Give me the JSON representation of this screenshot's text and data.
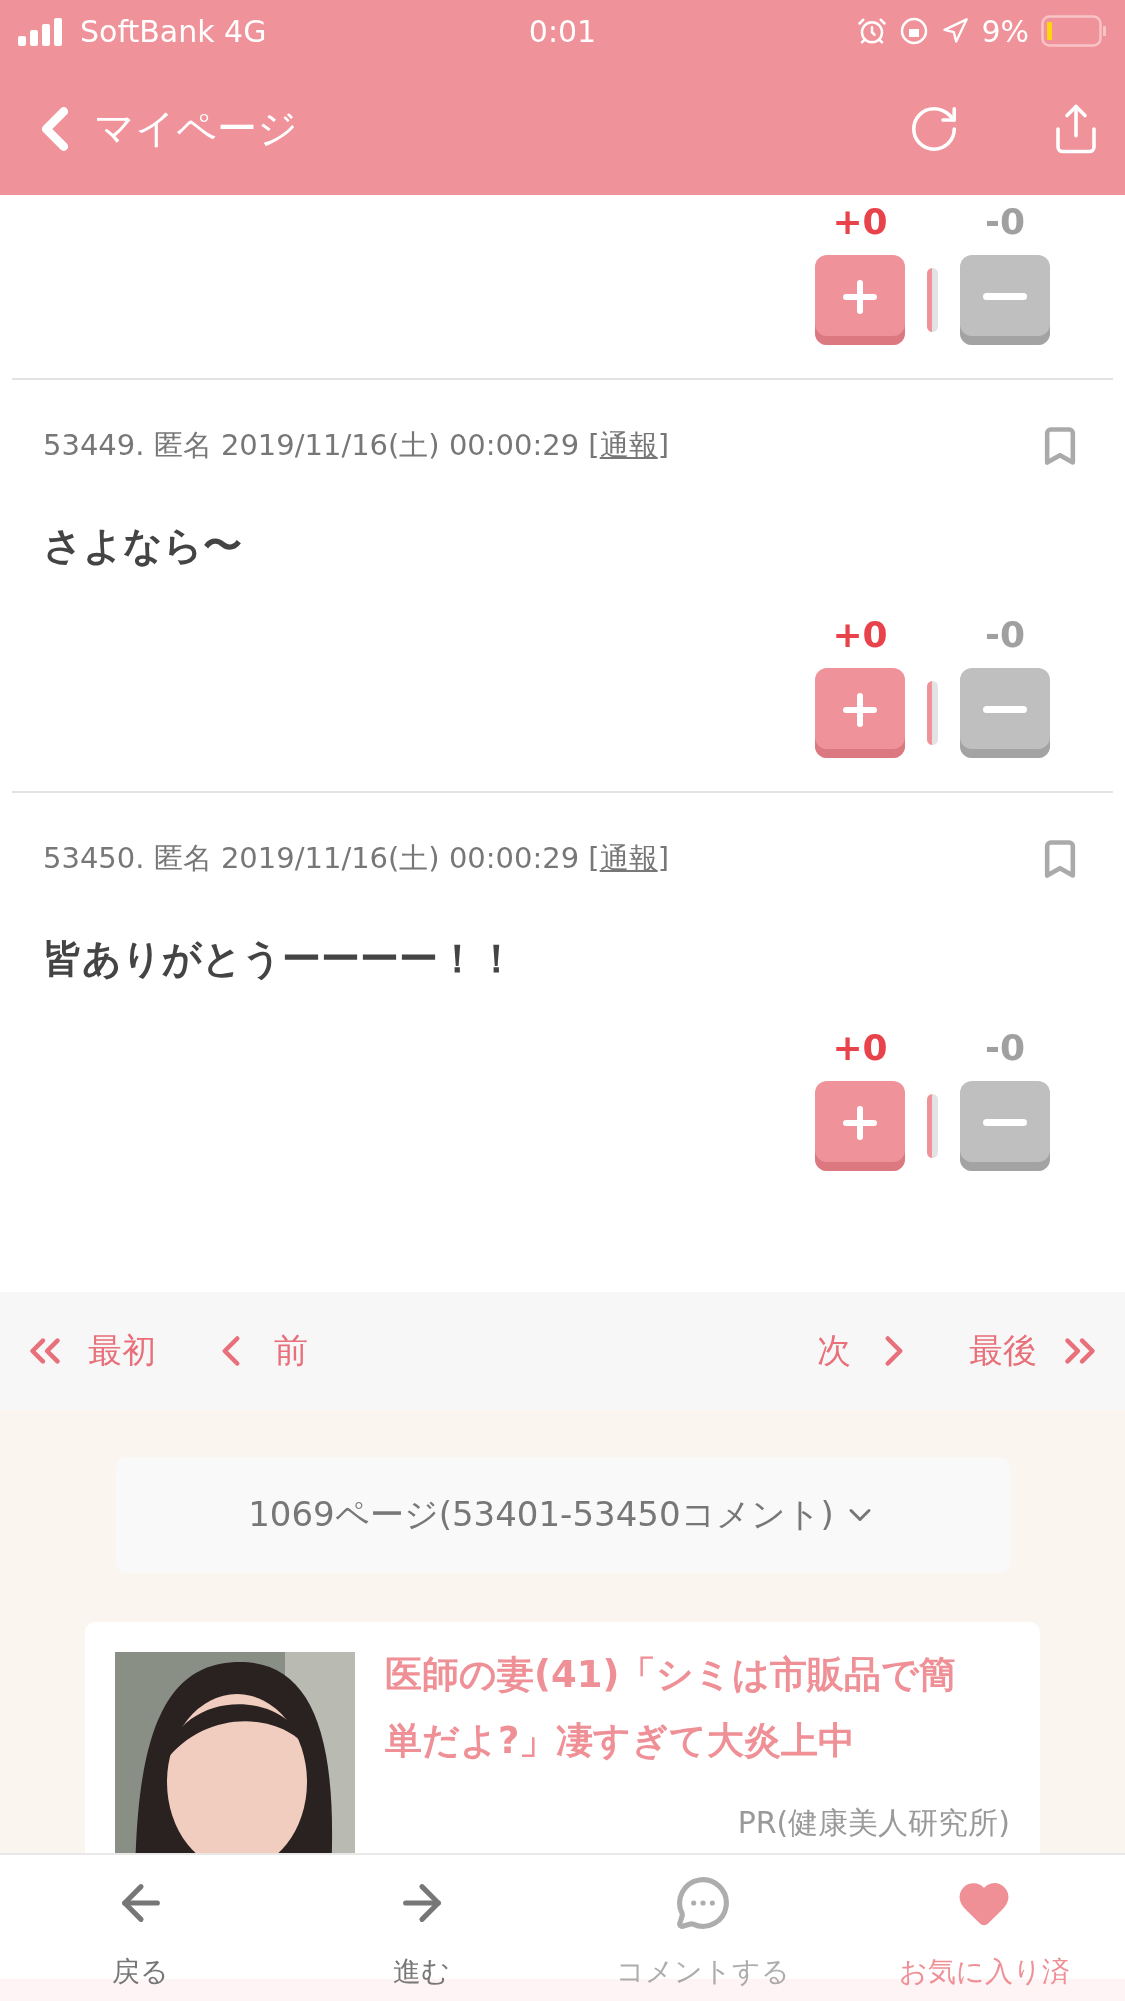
{
  "status_bar": {
    "carrier": "SoftBank 4G",
    "time": "0:01",
    "battery": "9%"
  },
  "header": {
    "back_label": "マイページ"
  },
  "comments": [
    {
      "plus": "+0",
      "minus": "-0"
    },
    {
      "meta": "53449. 匿名 2019/11/16(土) 00:00:29 [",
      "report": "通報",
      "meta_end": "]",
      "body": "さよなら〜",
      "plus": "+0",
      "minus": "-0"
    },
    {
      "meta": "53450. 匿名 2019/11/16(土) 00:00:29 [",
      "report": "通報",
      "meta_end": "]",
      "body": "皆ありがとうーーーー！！",
      "plus": "+0",
      "minus": "-0"
    }
  ],
  "pagination": [
    {
      "kind": "first",
      "label": "最初"
    },
    {
      "kind": "prev",
      "label": "前"
    },
    {
      "kind": "next",
      "label": "次"
    },
    {
      "kind": "last",
      "label": "最後"
    }
  ],
  "page_select": {
    "label": "1069ページ(53401-53450コメント)"
  },
  "ad": {
    "title": "医師の妻(41)「シミは市販品で簡単だよ?」凄すぎて大炎上中",
    "sponsor": "PR(健康美人研究所)"
  },
  "toolbar": [
    {
      "kind": "back",
      "label": "戻る",
      "disabled": false,
      "active": false
    },
    {
      "kind": "forward",
      "label": "進む",
      "disabled": false,
      "active": false
    },
    {
      "kind": "comment",
      "label": "コメントする",
      "disabled": true,
      "active": false
    },
    {
      "kind": "favorite",
      "label": "お気に入り済",
      "disabled": false,
      "active": true
    }
  ]
}
